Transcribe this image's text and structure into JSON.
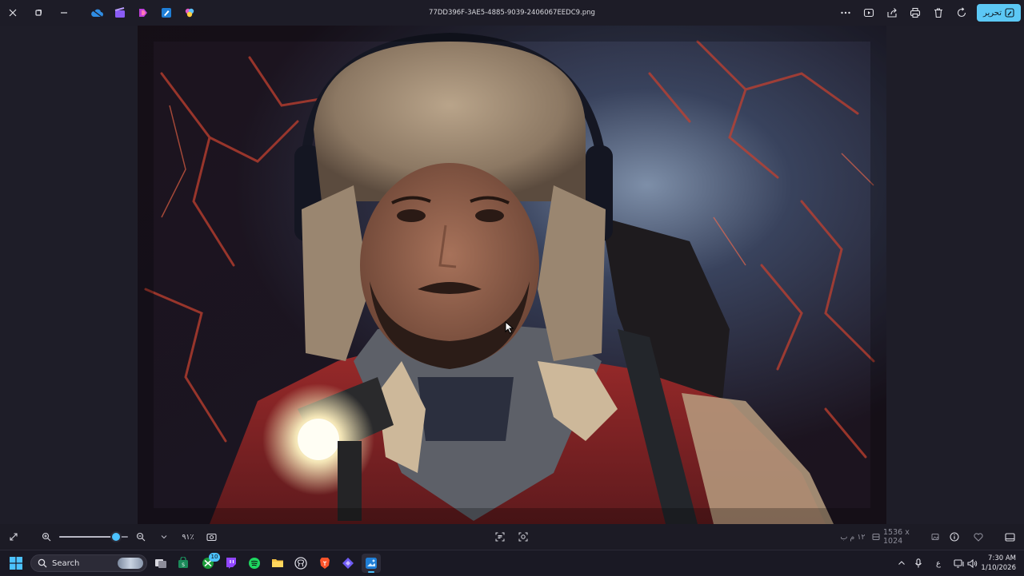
{
  "titlebar": {
    "filename": "77DD396F-3AE5-4885-9039-2406067EEDC9.png",
    "edit_label": "تحرير"
  },
  "bottombar": {
    "zoom_percent": 91,
    "zoom_label": "٩١٪",
    "time_label": "١٢ م ب",
    "dimensions": "1536 x 1024"
  },
  "taskbar": {
    "search_placeholder": "Search",
    "xbox_badge": "10",
    "lang": "ع",
    "time": "7:30 AM",
    "date": "1/10/2026"
  },
  "colors": {
    "accent": "#4cc2ff",
    "edit_button": "#5cc8f5",
    "background": "#1e1d28"
  }
}
